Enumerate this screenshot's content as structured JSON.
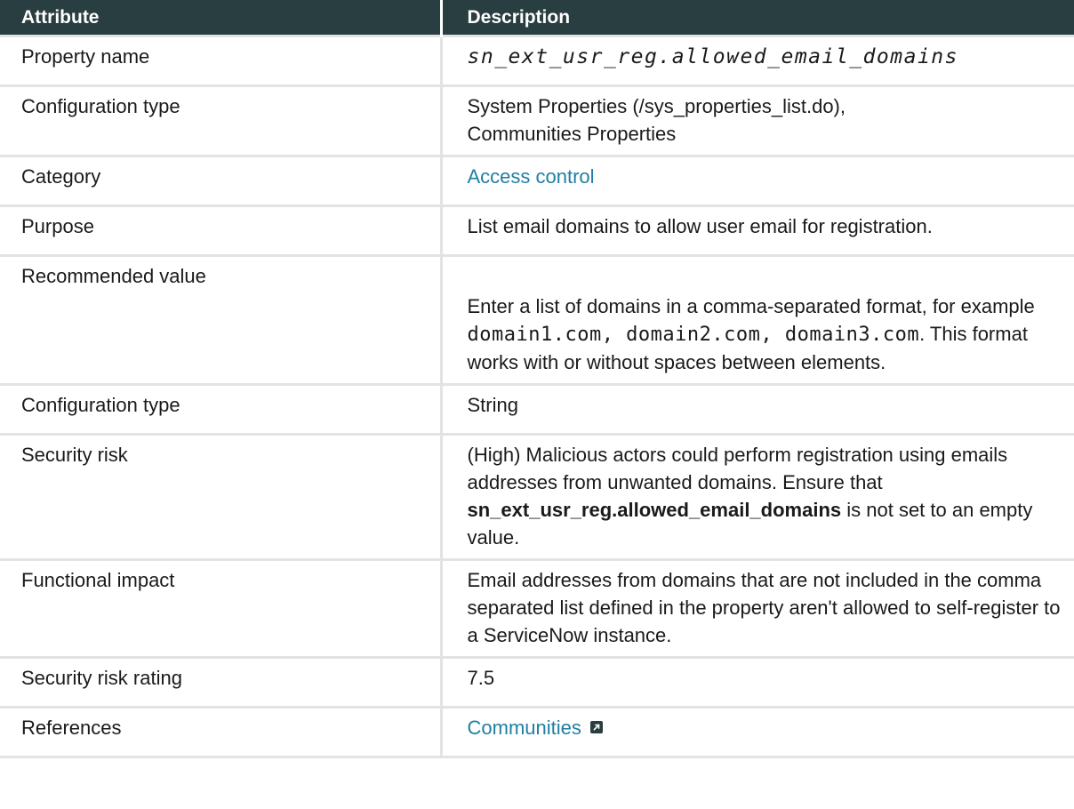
{
  "header": {
    "col1": "Attribute",
    "col2": "Description"
  },
  "rows": {
    "property_name": {
      "attribute": "Property name",
      "value": "sn_ext_usr_reg.allowed_email_domains"
    },
    "configuration_type_1": {
      "attribute": "Configuration type",
      "line1": "System Properties (/sys_properties_list.do),",
      "line2": "Communities Properties"
    },
    "category": {
      "attribute": "Category",
      "link": "Access control"
    },
    "purpose": {
      "attribute": "Purpose",
      "value": "List email domains to allow user email for registration."
    },
    "recommended_value": {
      "attribute": "Recommended value",
      "text1": "Enter a list of domains in a comma-separated format, for example ",
      "code": "domain1.com, domain2.com, domain3.com",
      "text2": ". This format works with or without spaces between elements."
    },
    "configuration_type_2": {
      "attribute": "Configuration type",
      "value": "String"
    },
    "security_risk": {
      "attribute": "Security risk",
      "text1": "(High) Malicious actors could perform registration using emails addresses from unwanted domains. Ensure that ",
      "bold": "sn_ext_usr_reg.allowed_email_domains",
      "text2": " is not set to an empty value."
    },
    "functional_impact": {
      "attribute": "Functional impact",
      "value": "Email addresses from domains that are not included in the comma separated list defined in the property aren't allowed to self-register to a ServiceNow instance."
    },
    "security_risk_rating": {
      "attribute": "Security risk rating",
      "value": "7.5"
    },
    "references": {
      "attribute": "References",
      "link": "Communities",
      "icon": "external-link-icon"
    }
  }
}
